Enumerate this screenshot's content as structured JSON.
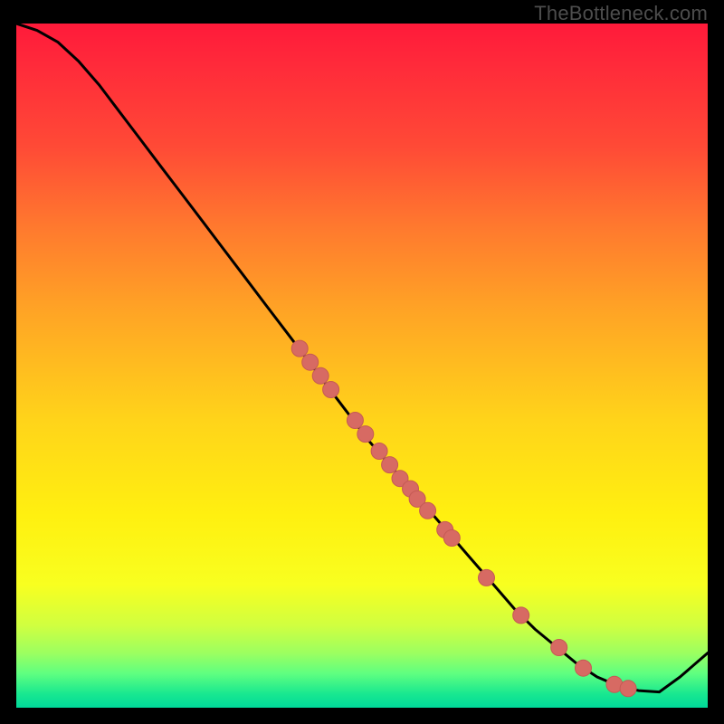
{
  "watermark": "TheBottleneck.com",
  "colors": {
    "line": "#000000",
    "marker_fill": "#d76a63",
    "marker_stroke": "#c55a54"
  },
  "chart_data": {
    "type": "line",
    "title": "",
    "xlabel": "",
    "ylabel": "",
    "xlim": [
      0,
      100
    ],
    "ylim": [
      0,
      100
    ],
    "x": [
      0,
      3,
      6,
      9,
      12,
      15,
      18,
      21,
      24,
      27,
      30,
      33,
      36,
      39,
      42,
      45,
      48,
      51,
      54,
      57,
      60,
      63,
      66,
      69,
      72,
      75,
      78,
      81,
      84,
      87,
      90,
      93,
      96,
      100
    ],
    "values": [
      100,
      99.0,
      97.3,
      94.5,
      91.0,
      87.0,
      83.0,
      79.0,
      75.0,
      71.0,
      67.0,
      63.0,
      59.0,
      55.0,
      51.0,
      47.0,
      43.0,
      39.0,
      35.5,
      32.0,
      28.5,
      25.0,
      21.5,
      18.0,
      14.5,
      11.5,
      9.0,
      6.5,
      4.5,
      3.2,
      2.5,
      2.3,
      4.5,
      8.0
    ],
    "markers_x": [
      41,
      42.5,
      44,
      45.5,
      49,
      50.5,
      52.5,
      54,
      55.5,
      57,
      58,
      59.5,
      62,
      63,
      68,
      73,
      78.5,
      82,
      86.5,
      88.5
    ],
    "markers_y": [
      52.5,
      50.5,
      48.5,
      46.5,
      42.0,
      40.0,
      37.5,
      35.5,
      33.5,
      32.0,
      30.5,
      28.8,
      26.0,
      24.8,
      19.0,
      13.5,
      8.8,
      5.8,
      3.4,
      2.8
    ]
  }
}
